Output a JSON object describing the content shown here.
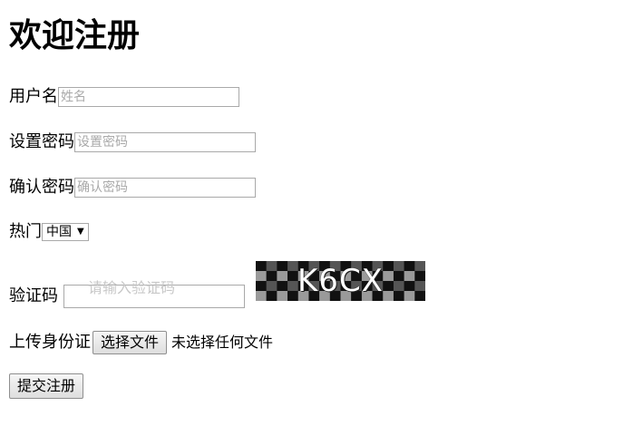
{
  "title": "欢迎注册",
  "form": {
    "username_label": "用户名",
    "username_placeholder": "姓名",
    "password_label": "设置密码",
    "password_placeholder": "设置密码",
    "confirm_label": "确认密码",
    "confirm_placeholder": "确认密码",
    "hot_label": "热门",
    "hot_selected": "中国",
    "captcha_label": "验证码",
    "captcha_placeholder": "请输入验证码",
    "captcha_code": "K6CX",
    "upload_label": "上传身份证",
    "upload_button": "选择文件",
    "upload_status": "未选择任何文件",
    "submit_button": "提交注册"
  },
  "icons": {
    "select_arrow": "chevron-down-icon"
  },
  "colors": {
    "input_border": "#a9a9a9",
    "placeholder": "#a9a9a9",
    "captcha_dark": "#111111",
    "captcha_mid": "#555555",
    "captcha_light": "#9a9a9a"
  }
}
